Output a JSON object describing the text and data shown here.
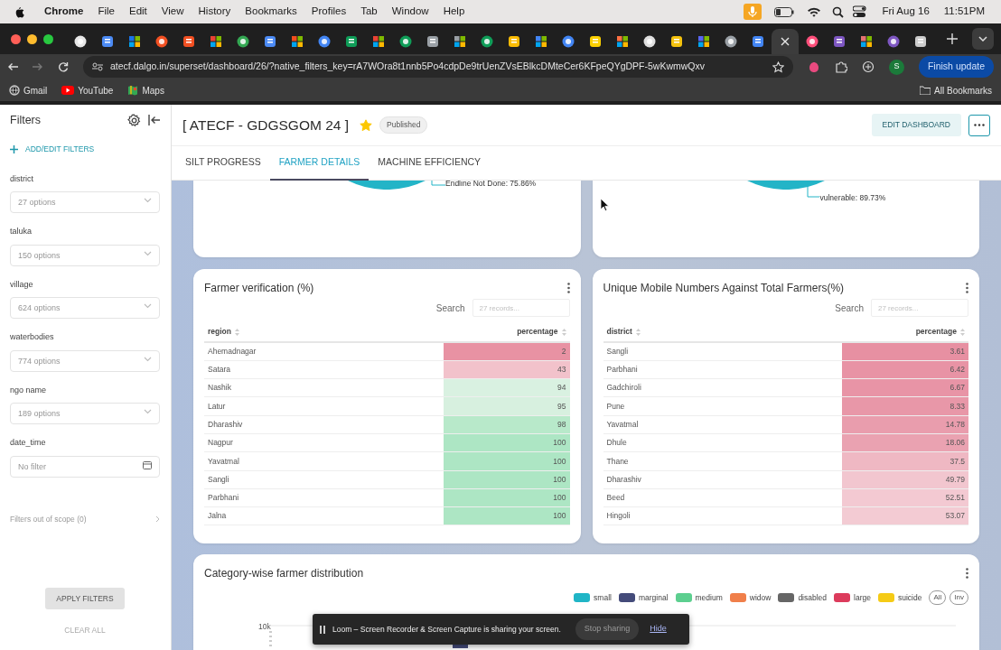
{
  "menu_bar": {
    "app": "Chrome",
    "items": [
      "File",
      "Edit",
      "View",
      "History",
      "Bookmarks",
      "Profiles",
      "Tab",
      "Window",
      "Help"
    ],
    "date": "Fri Aug 16",
    "time": "11:51PM"
  },
  "browser_tabs": [
    {
      "selected": false
    },
    {
      "selected": false
    },
    {
      "selected": false
    },
    {
      "selected": false
    },
    {
      "selected": false
    },
    {
      "selected": false
    },
    {
      "selected": false
    },
    {
      "selected": false
    },
    {
      "selected": false
    },
    {
      "selected": false
    },
    {
      "selected": false
    },
    {
      "selected": false
    },
    {
      "selected": false
    },
    {
      "selected": false
    },
    {
      "selected": false
    },
    {
      "selected": false
    },
    {
      "selected": false
    },
    {
      "selected": false
    },
    {
      "selected": false
    },
    {
      "selected": false
    },
    {
      "selected": false
    },
    {
      "selected": false
    },
    {
      "selected": false
    },
    {
      "selected": false
    },
    {
      "selected": false
    },
    {
      "selected": false
    },
    {
      "selected": true
    },
    {
      "selected": false
    },
    {
      "selected": false
    },
    {
      "selected": false
    },
    {
      "selected": false
    },
    {
      "selected": false
    }
  ],
  "address_bar": {
    "url": "atecf.dalgo.in/superset/dashboard/26/?native_filters_key=rA7WOra8t1nnb5Po4cdpDe9trUenZVsEBlkcDMteCer6KFpeQYgDPF-5wKwmwQxv",
    "profile": "S",
    "update_button": "Finish update"
  },
  "bookmarks": [
    {
      "label": "Gmail",
      "kind": "gmail"
    },
    {
      "label": "YouTube",
      "kind": "youtube"
    },
    {
      "label": "Maps",
      "kind": "maps"
    }
  ],
  "all_bookmarks": "All Bookmarks",
  "filters": {
    "title": "Filters",
    "add_edit": "ADD/EDIT FILTERS",
    "fields": [
      {
        "label": "district",
        "placeholder": "27 options",
        "kind": "select"
      },
      {
        "label": "taluka",
        "placeholder": "150 options",
        "kind": "select"
      },
      {
        "label": "village",
        "placeholder": "624 options",
        "kind": "select"
      },
      {
        "label": "waterbodies",
        "placeholder": "774 options",
        "kind": "select"
      },
      {
        "label": "ngo name",
        "placeholder": "189 options",
        "kind": "select"
      },
      {
        "label": "date_time",
        "placeholder": "No filter",
        "kind": "date"
      }
    ],
    "out_of_scope": "Filters out of scope (0)",
    "apply": "APPLY FILTERS",
    "clear": "CLEAR ALL"
  },
  "dashboard": {
    "title": "[ ATECF - GDGSGOM 24 ]",
    "favorite": true,
    "status": "Published",
    "edit_button": "EDIT DASHBOARD"
  },
  "tabs": [
    {
      "label": "SILT PROGRESS",
      "selected": false
    },
    {
      "label": "FARMER DETAILS",
      "selected": true
    },
    {
      "label": "MACHINE EFFICIENCY",
      "selected": false
    }
  ],
  "pie_labels": [
    "Endline Not Done: 75.86%",
    "vulnerable: 89.73%"
  ],
  "tables": [
    {
      "title": "Farmer verification (%)",
      "search_label": "Search",
      "search_placeholder": "27 records...",
      "columns": [
        "region",
        "percentage"
      ],
      "rows": [
        {
          "name": "Ahemadnagar",
          "value": "2",
          "color": "#e892a3"
        },
        {
          "name": "Satara",
          "value": "43",
          "color": "#f2c2cb"
        },
        {
          "name": "Nashik",
          "value": "94",
          "color": "#d9f1e1"
        },
        {
          "name": "Latur",
          "value": "95",
          "color": "#d7f0df"
        },
        {
          "name": "Dharashiv",
          "value": "98",
          "color": "#b8e9ca"
        },
        {
          "name": "Nagpur",
          "value": "100",
          "color": "#ade6c4"
        },
        {
          "name": "Yavatmal",
          "value": "100",
          "color": "#ade6c4"
        },
        {
          "name": "Sangli",
          "value": "100",
          "color": "#ade6c4"
        },
        {
          "name": "Parbhani",
          "value": "100",
          "color": "#ade6c4"
        },
        {
          "name": "Jalna",
          "value": "100",
          "color": "#ade6c4"
        }
      ]
    },
    {
      "title": "Unique Mobile Numbers Against Total Farmers(%)",
      "search_label": "Search",
      "search_placeholder": "27 records...",
      "columns": [
        "district",
        "percentage"
      ],
      "rows": [
        {
          "name": "Sangli",
          "value": "3.61",
          "color": "#e790a2"
        },
        {
          "name": "Parbhani",
          "value": "6.42",
          "color": "#e893a5"
        },
        {
          "name": "Gadchiroli",
          "value": "6.67",
          "color": "#e894a6"
        },
        {
          "name": "Pune",
          "value": "8.33",
          "color": "#e897a8"
        },
        {
          "name": "Yavatmal",
          "value": "14.78",
          "color": "#e99dad"
        },
        {
          "name": "Dhule",
          "value": "18.06",
          "color": "#eaa2b1"
        },
        {
          "name": "Thane",
          "value": "37.5",
          "color": "#efb8c3"
        },
        {
          "name": "Dharashiv",
          "value": "49.79",
          "color": "#f2c6cf"
        },
        {
          "name": "Beed",
          "value": "52.51",
          "color": "#f3c9d2"
        },
        {
          "name": "Hingoli",
          "value": "53.07",
          "color": "#f3cbd3"
        }
      ]
    }
  ],
  "category_chart": {
    "title": "Category-wise farmer distribution",
    "legend": [
      {
        "label": "small",
        "color": "#20b5c6"
      },
      {
        "label": "marginal",
        "color": "#444b7a"
      },
      {
        "label": "medium",
        "color": "#5ccf8f"
      },
      {
        "label": "widow",
        "color": "#f07f4a"
      },
      {
        "label": "disabled",
        "color": "#666666"
      },
      {
        "label": "large",
        "color": "#dc3b5c"
      },
      {
        "label": "suicide",
        "color": "#f5cb16"
      }
    ],
    "all_button": "All",
    "inv_button": "Inv",
    "y_tick": "10k"
  },
  "screen_share": {
    "message": "Loom – Screen Recorder & Screen Capture is sharing your screen.",
    "stop": "Stop sharing",
    "hide": "Hide"
  }
}
